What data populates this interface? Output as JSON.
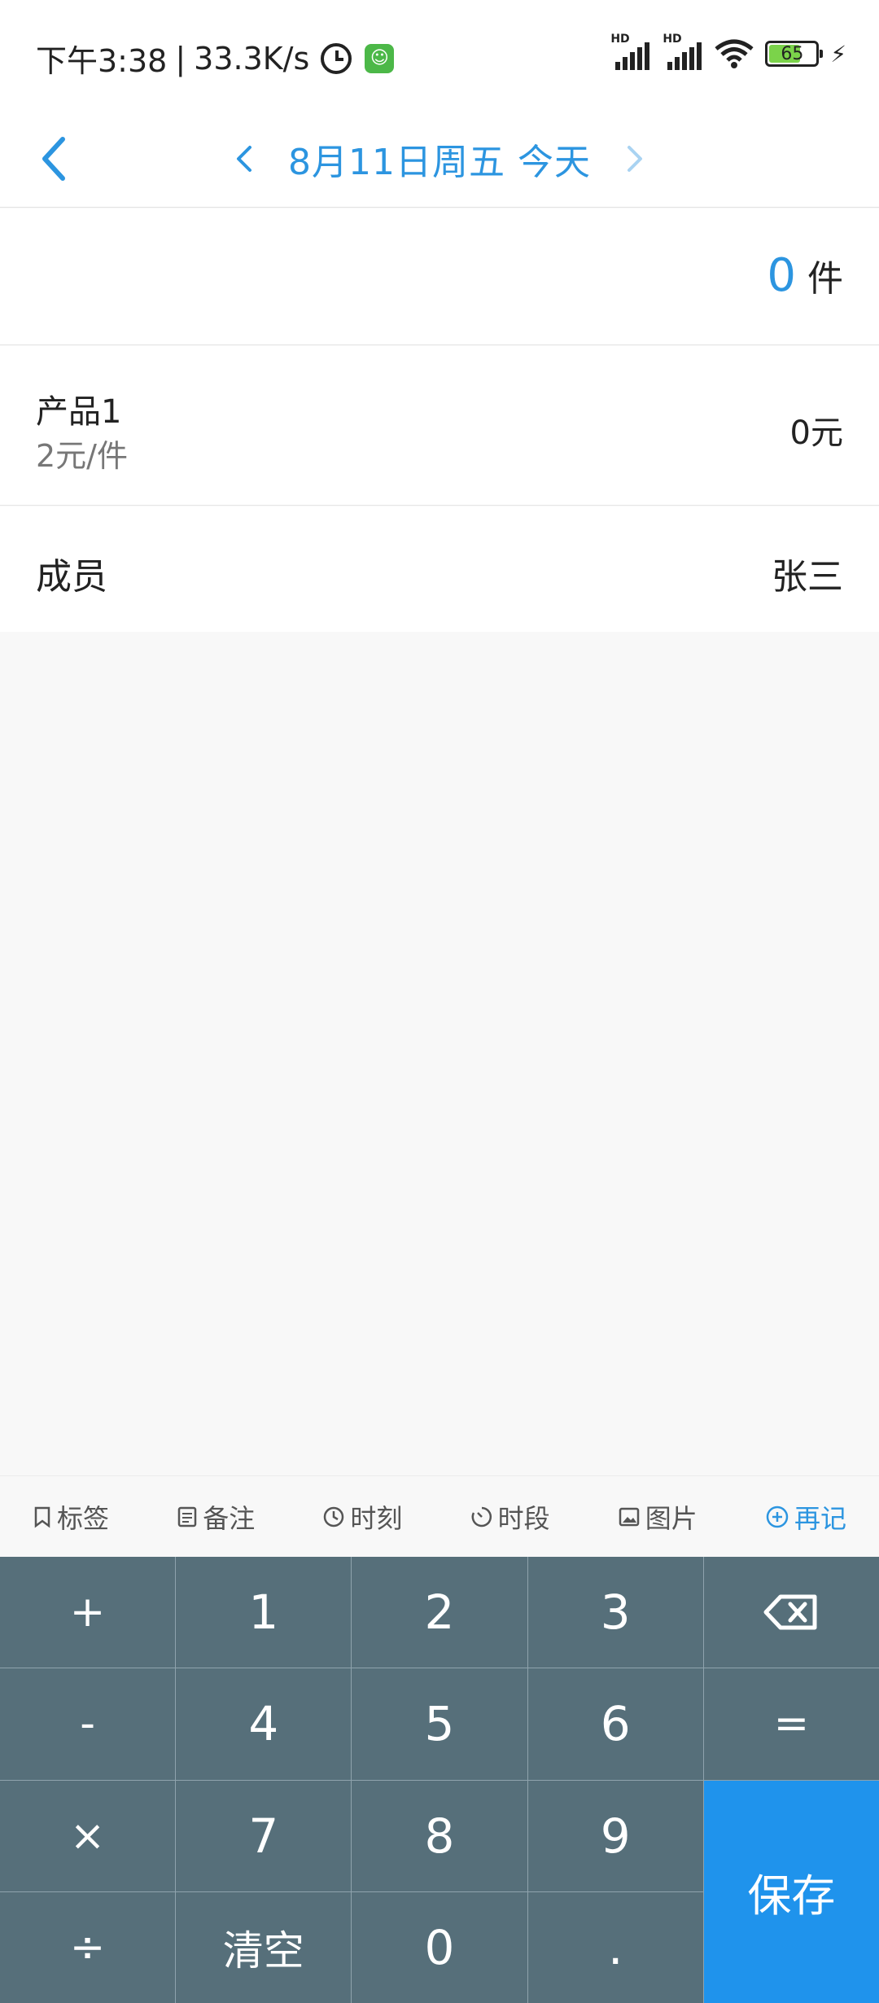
{
  "status_bar": {
    "time": "下午3:38",
    "separator": "|",
    "network_speed": "33.3K/s",
    "battery_level": "65",
    "signal_tag_1": "HD",
    "signal_tag_2": "HD",
    "icons": [
      "alarm-icon",
      "app-notification-icon",
      "signal-icon",
      "signal-icon",
      "wifi-icon",
      "battery-icon",
      "charging-icon"
    ]
  },
  "header": {
    "date_label": "8月11日周五 今天",
    "accent_color": "#2c95e0"
  },
  "quantity": {
    "value": "0",
    "unit": "件"
  },
  "product": {
    "name": "产品1",
    "price": "2元/件",
    "amount": "0元"
  },
  "member": {
    "label": "成员",
    "value": "张三"
  },
  "toolbar": {
    "tag_label": "标签",
    "note_label": "备注",
    "time_label": "时刻",
    "period_label": "时段",
    "image_label": "图片",
    "again_label": "再记"
  },
  "keypad": {
    "keys": {
      "plus": "+",
      "one": "1",
      "two": "2",
      "three": "3",
      "minus": "-",
      "four": "4",
      "five": "5",
      "six": "6",
      "equals": "=",
      "times": "×",
      "seven": "7",
      "eight": "8",
      "nine": "9",
      "divide": "÷",
      "clear": "清空",
      "zero": "0",
      "dot": "."
    },
    "save_label": "保存",
    "key_color": "#566f7a",
    "save_color": "#1f93ec"
  }
}
